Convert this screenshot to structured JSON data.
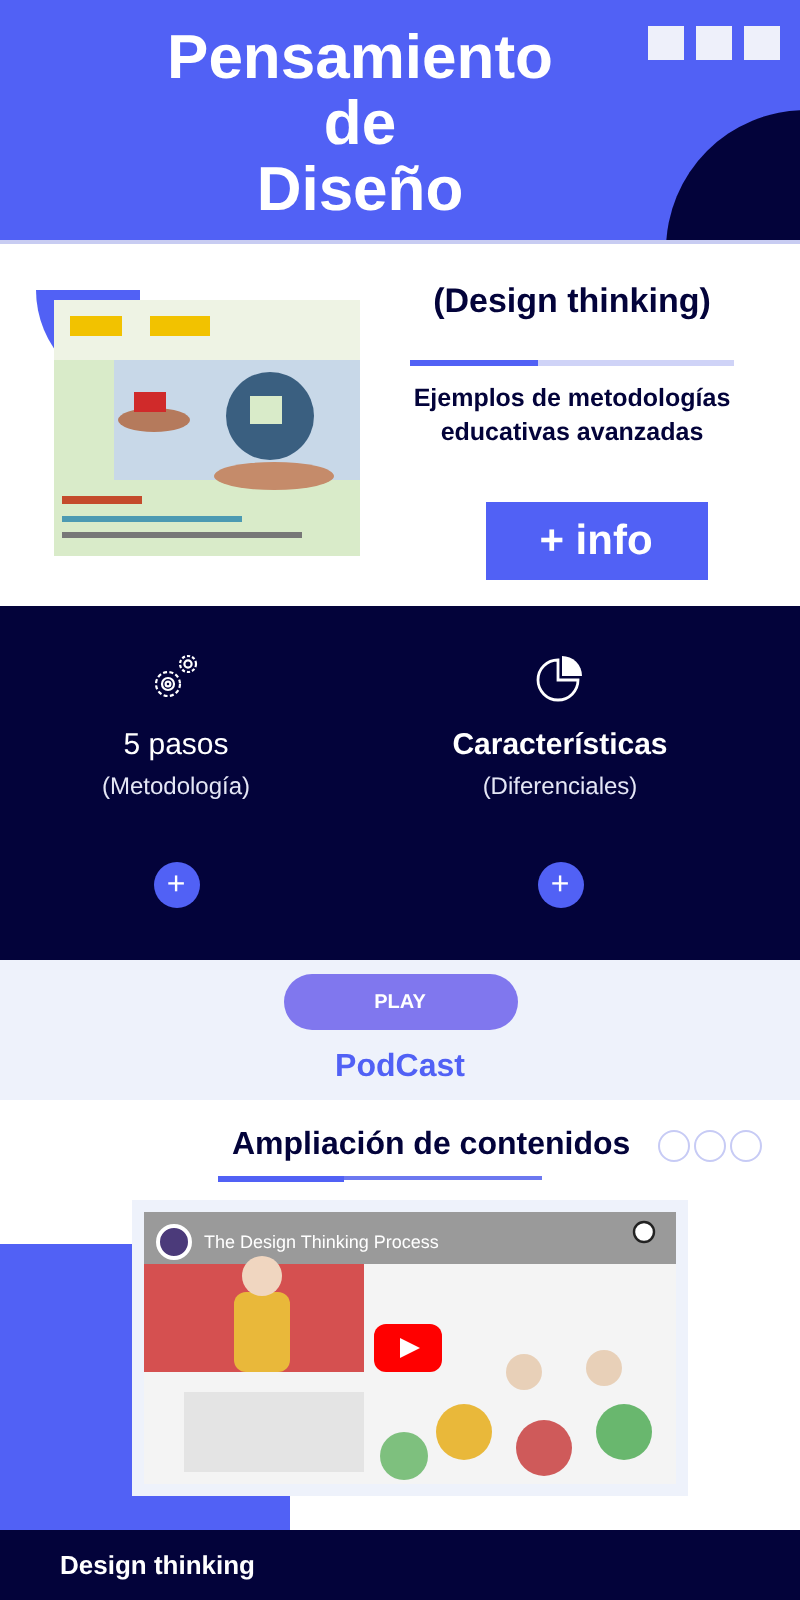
{
  "header": {
    "title_lines": [
      "Pensamiento",
      "de",
      "Diseño"
    ]
  },
  "intro": {
    "subtitle": "(Design thinking)",
    "description": "Ejemplos de metodologías educativas avanzadas",
    "button": "+ info"
  },
  "features": [
    {
      "kind": "gears",
      "title": "5 pasos",
      "title_bold": false,
      "subtitle": "(Metodología)",
      "button": "+"
    },
    {
      "kind": "pie",
      "title": "Características",
      "title_bold": true,
      "subtitle": "(Diferenciales)",
      "button": "+"
    }
  ],
  "podcast": {
    "button": "PLAY",
    "label": "PodCast"
  },
  "more": {
    "title": "Ampliación de contenidos",
    "video": {
      "title": "The Design Thinking Process"
    }
  },
  "footer": {
    "text": "Design thinking"
  }
}
